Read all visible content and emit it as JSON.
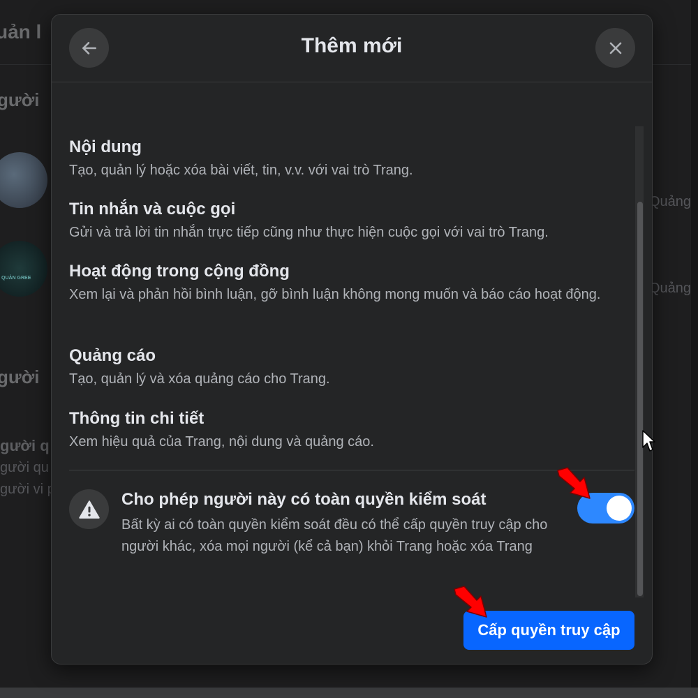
{
  "background": {
    "title": "uản l",
    "section_1": "gười",
    "section_2": "gười",
    "side_text_1": "Quảng",
    "side_text_2": "Quảng",
    "avatar_2_label": "QUẢN GREE",
    "row_strong": "gười q",
    "row_line_1": "gười qu",
    "row_line_2": "gười vi p"
  },
  "modal": {
    "title": "Thêm mới",
    "back_icon": "arrow-left-icon",
    "close_icon": "close-icon",
    "permissions": [
      {
        "title": "Nội dung",
        "description": "Tạo, quản lý hoặc xóa bài viết, tin, v.v. với vai trò Trang."
      },
      {
        "title": "Tin nhắn và cuộc gọi",
        "description": "Gửi và trả lời tin nhắn trực tiếp cũng như thực hiện cuộc gọi với vai trò Trang."
      },
      {
        "title": "Hoạt động trong cộng đồng",
        "description": "Xem lại và phản hồi bình luận, gỡ bình luận không mong muốn và báo cáo hoạt động."
      },
      {
        "title": "Quảng cáo",
        "description": "Tạo, quản lý và xóa quảng cáo cho Trang."
      },
      {
        "title": "Thông tin chi tiết",
        "description": "Xem hiệu quả của Trang, nội dung và quảng cáo."
      }
    ],
    "full_control": {
      "icon": "warning-icon",
      "title": "Cho phép người này có toàn quyền kiểm soát",
      "description": "Bất kỳ ai có toàn quyền kiểm soát đều có thể cấp quyền truy cập cho người khác, xóa mọi người (kể cả bạn) khỏi Trang hoặc xóa Trang",
      "toggle_on": true
    },
    "grant_button_label": "Cấp quyền truy cập"
  },
  "colors": {
    "accent": "#0866ff",
    "toggle": "#2d88ff",
    "annotation_arrow": "#ff0000",
    "modal_bg": "#242526"
  }
}
